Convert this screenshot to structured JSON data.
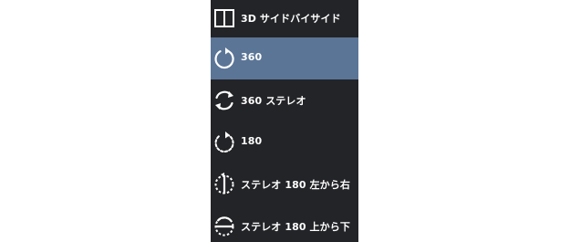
{
  "menu": {
    "items": [
      {
        "label": "3D サイドバイサイド",
        "icon": "side-by-side-icon",
        "selected": false
      },
      {
        "label": "360",
        "icon": "rotate-360-icon",
        "selected": true
      },
      {
        "label": "360 ステレオ",
        "icon": "stereo-360-icon",
        "selected": false
      },
      {
        "label": "180",
        "icon": "rotate-180-icon",
        "selected": false
      },
      {
        "label": "ステレオ 180 左から右",
        "icon": "stereo-180-left-right-icon",
        "selected": false
      },
      {
        "label": "ステレオ 180 上から下",
        "icon": "stereo-180-top-bottom-icon",
        "selected": false
      }
    ]
  },
  "colors": {
    "menu_background": "#232427",
    "selected_background": "#5b7597",
    "text": "#ffffff"
  }
}
